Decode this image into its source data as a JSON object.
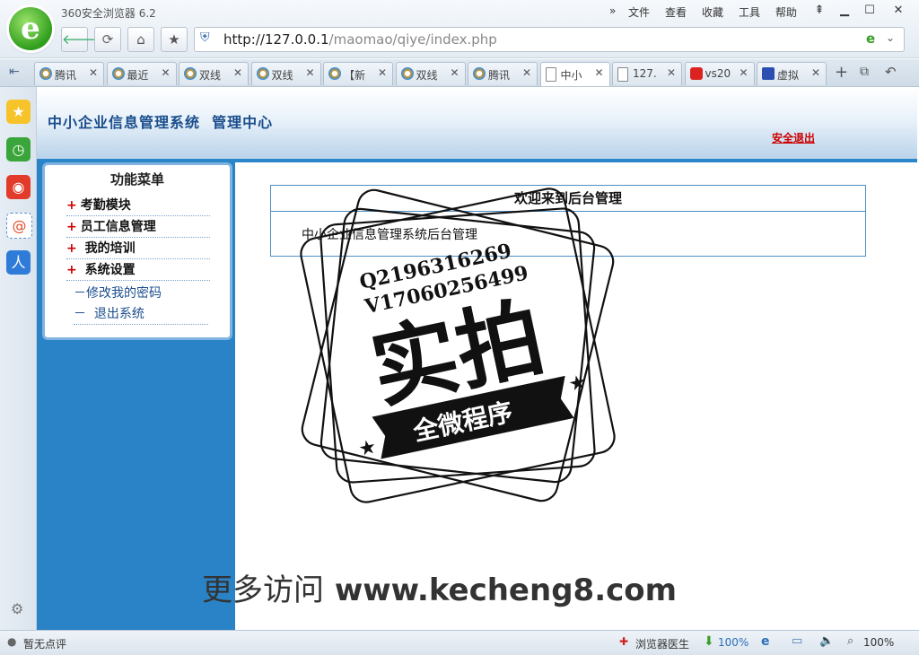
{
  "browser": {
    "app_name": "360安全浏览器 6.2",
    "menu": [
      "文件",
      "查看",
      "收藏",
      "工具",
      "帮助"
    ],
    "url_host": "http://127.0.0.1",
    "url_path": "/maomao/qiye/index.php",
    "tabs": [
      {
        "label": "腾讯"
      },
      {
        "label": "最近"
      },
      {
        "label": "双线"
      },
      {
        "label": "双线"
      },
      {
        "label": "【新"
      },
      {
        "label": "双线"
      },
      {
        "label": "腾讯"
      },
      {
        "label": "中小"
      },
      {
        "label": "127."
      },
      {
        "label": "vs20"
      },
      {
        "label": "虚拟"
      }
    ],
    "status": {
      "left": "暂无点评",
      "doctor": "浏览器医生",
      "download": "100%",
      "zoom": "100%"
    }
  },
  "page": {
    "system_title": "中小企业信息管理系统  管理中心",
    "logout": "安全退出",
    "menu_title": "功能菜单",
    "menu_items": [
      "考勤模块",
      "员工信息管理",
      " 我的培训",
      " 系统设置"
    ],
    "sub_items": [
      "－修改我的密码",
      "－  退出系统"
    ],
    "welcome_head": "欢迎来到后台管理",
    "welcome_text": "中小企业信息管理系统后台管理"
  },
  "watermark": {
    "qq": "Q2196316269",
    "v": "V17060256499",
    "big": "实拍",
    "ribbon": "全微程序",
    "footer_cn": "更多访问",
    "footer_url": "www.kecheng8.com"
  }
}
